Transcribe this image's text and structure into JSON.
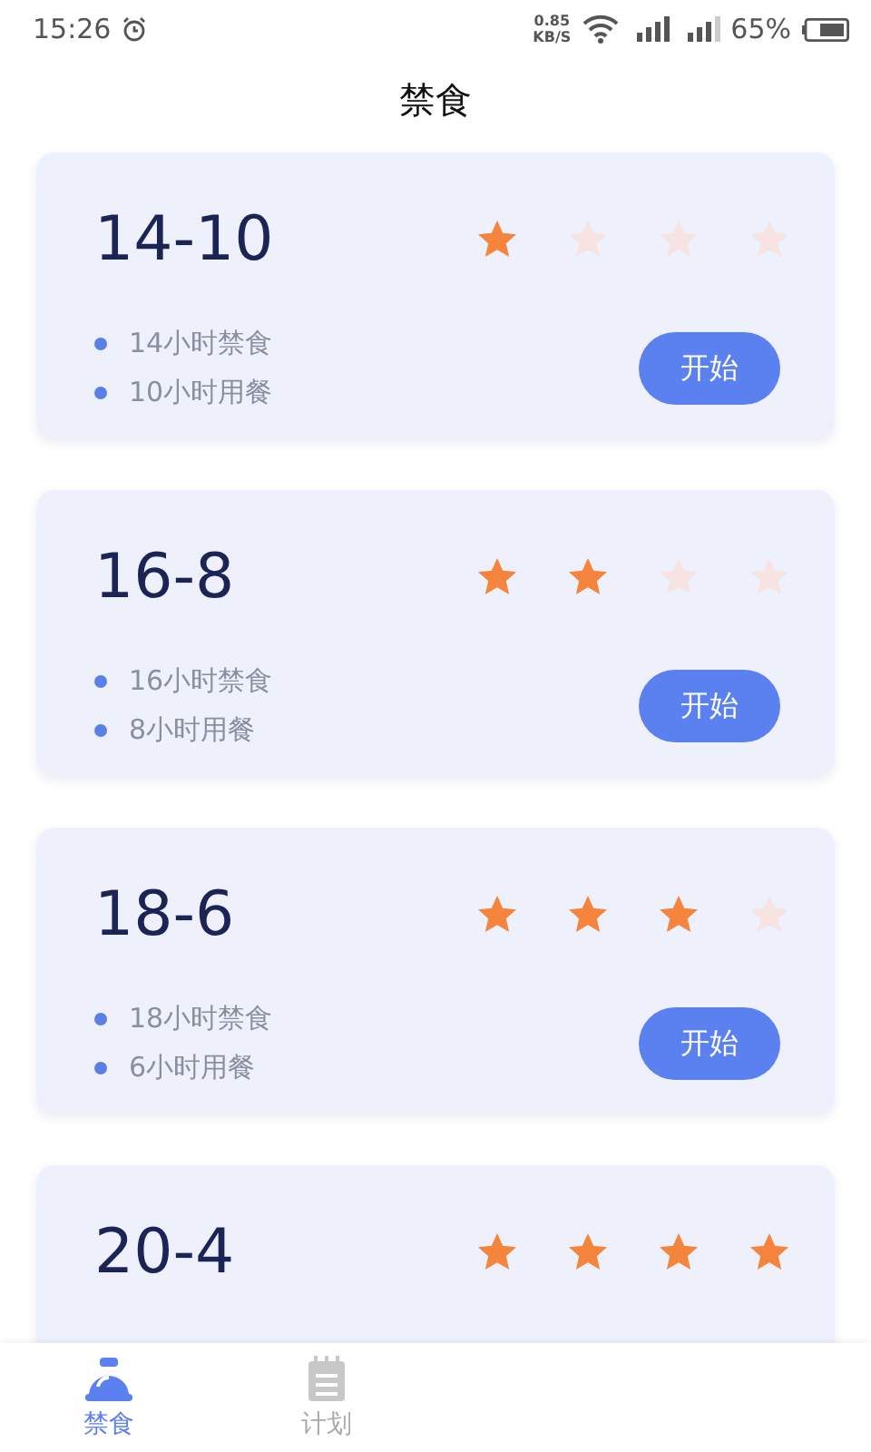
{
  "status_bar": {
    "time": "15:26",
    "net_speed_value": "0.85",
    "net_speed_unit": "KB/S",
    "battery": "65%"
  },
  "title": "禁食",
  "plans": [
    {
      "name": "14-10",
      "stars": 1,
      "lines": [
        "14小时禁食",
        "10小时用餐"
      ],
      "button": "开始"
    },
    {
      "name": "16-8",
      "stars": 2,
      "lines": [
        "16小时禁食",
        "8小时用餐"
      ],
      "button": "开始"
    },
    {
      "name": "18-6",
      "stars": 3,
      "lines": [
        "18小时禁食",
        "6小时用餐"
      ],
      "button": "开始"
    },
    {
      "name": "20-4",
      "stars": 4
    }
  ],
  "tabs": [
    {
      "label": "禁食",
      "selected": true,
      "kind": "bell"
    },
    {
      "label": "计划",
      "selected": false,
      "kind": "notepad"
    }
  ]
}
